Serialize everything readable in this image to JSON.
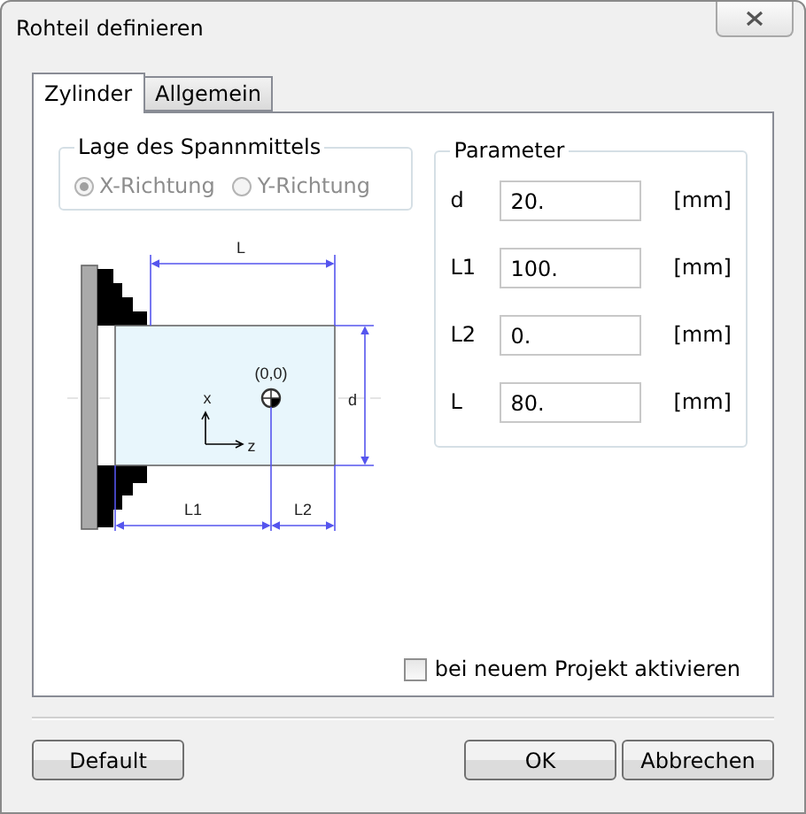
{
  "window": {
    "title": "Rohteil definieren"
  },
  "tabs": [
    {
      "label": "Zylinder",
      "selected": true
    },
    {
      "label": "Allgemein",
      "selected": false
    }
  ],
  "clamp_group": {
    "title": "Lage des Spannmittels",
    "options": [
      {
        "label": "X-Richtung",
        "selected": true,
        "disabled": true
      },
      {
        "label": "Y-Richtung",
        "selected": false,
        "disabled": true
      }
    ]
  },
  "diagram": {
    "length_label": "L",
    "diameter_label": "d",
    "origin_label": "(0,0)",
    "x_axis_label": "x",
    "z_axis_label": "z",
    "l1_label": "L1",
    "l2_label": "L2"
  },
  "parameters": {
    "title": "Parameter",
    "rows": [
      {
        "label": "d",
        "value": "20.",
        "unit": "[mm]"
      },
      {
        "label": "L1",
        "value": "100.",
        "unit": "[mm]"
      },
      {
        "label": "L2",
        "value": "0.",
        "unit": "[mm]"
      },
      {
        "label": "L",
        "value": "80.",
        "unit": "[mm]"
      }
    ]
  },
  "activate_checkbox": {
    "label": "bei neuem Projekt aktivieren",
    "checked": false
  },
  "buttons": {
    "left": [
      "Default"
    ],
    "right": [
      "OK",
      "Abbrechen"
    ]
  }
}
